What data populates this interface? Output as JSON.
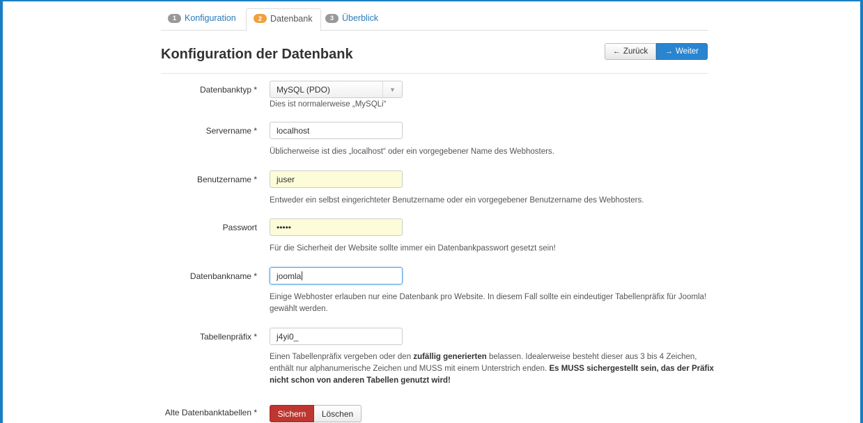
{
  "tabs": [
    {
      "step": "1",
      "label": "Konfiguration"
    },
    {
      "step": "2",
      "label": "Datenbank"
    },
    {
      "step": "3",
      "label": "Überblick"
    }
  ],
  "page_title": "Konfiguration der Datenbank",
  "nav": {
    "back_label": "Zurück",
    "next_label": "Weiter"
  },
  "fields": {
    "db_type": {
      "label": "Datenbanktyp *",
      "value": "MySQL (PDO)",
      "help": "Dies ist normalerweise „MySQLi“"
    },
    "server": {
      "label": "Servername *",
      "value": "localhost",
      "help": "Üblicherweise ist dies „localhost“ oder ein vorgegebener Name des Webhosters."
    },
    "user": {
      "label": "Benutzername *",
      "value": "juser",
      "help": "Entweder ein selbst eingerichteter Benutzername oder ein vorgegebener Benutzername des Webhosters."
    },
    "password": {
      "label": "Passwort",
      "value": "•••••",
      "help": "Für die Sicherheit der Website sollte immer ein Datenbankpasswort gesetzt sein!"
    },
    "db_name": {
      "label": "Datenbankname *",
      "value": "joomla",
      "help": "Einige Webhoster erlauben nur eine Datenbank pro Website. In diesem Fall sollte ein eindeutiger Tabellenpräfix für Joomla! gewählt werden."
    },
    "prefix": {
      "label": "Tabellenpräfix *",
      "value": "j4yi0_",
      "help_1": "Einen Tabellenpräfix vergeben oder den ",
      "help_bold_1": "zufällig generierten",
      "help_2": " belassen. Idealerweise besteht dieser aus 3 bis 4 Zeichen, enthält nur alphanumerische Zeichen und MUSS mit einem Unterstrich enden. ",
      "help_bold_2": "Es MUSS sichergestellt sein, das der Präfix nicht schon von anderen Tabellen genutzt wird!"
    },
    "old_tables": {
      "label": "Alte Datenbanktabellen *",
      "option_on": "Sichern",
      "option_off": "Löschen"
    }
  },
  "colors": {
    "accent": "#2a85d0",
    "active_step": "#f0a03c",
    "danger": "#bd362f",
    "autofill": "#fcfcd8"
  }
}
